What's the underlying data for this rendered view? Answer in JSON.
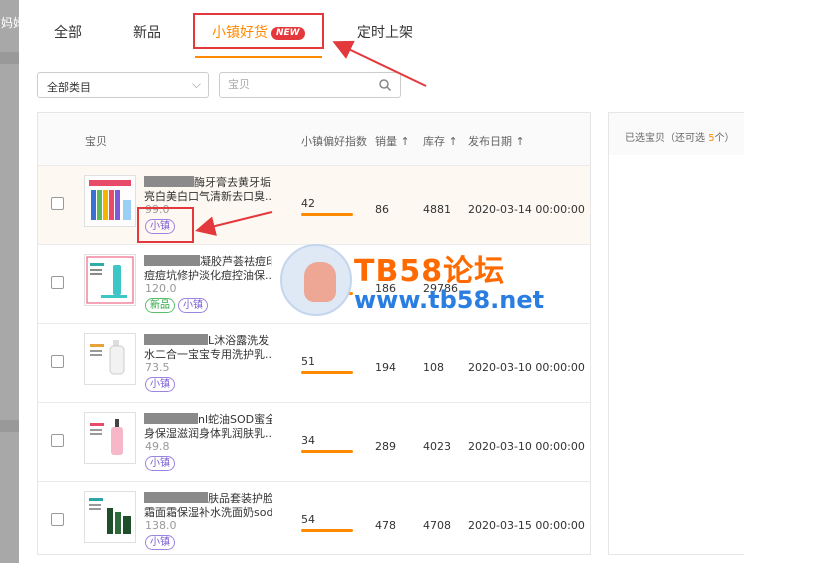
{
  "left_panel_label": "妈妈",
  "tabs": [
    {
      "label": "全部",
      "active": false
    },
    {
      "label": "新品",
      "active": false
    },
    {
      "label": "小镇好货",
      "active": true,
      "badge": "NEW"
    },
    {
      "label": "定时上架",
      "active": false
    }
  ],
  "filters": {
    "category_value": "全部类目",
    "search_placeholder": "宝贝"
  },
  "table": {
    "columns": {
      "item": "宝贝",
      "town_index": "小镇偏好指数",
      "sales": "销量 ↑",
      "stock": "库存 ↑",
      "publish_date": "发布日期 ↑"
    },
    "rows": [
      {
        "title_line1": "酶牙膏去黄牙垢",
        "title_line2": "亮白美白口气清新去口臭...",
        "price": "99.0",
        "tags": [
          "小镇"
        ],
        "town_index": "42",
        "sales": "86",
        "stock": "4881",
        "publish_date": "2020-03-14 00:00:00",
        "highlighted": true
      },
      {
        "title_line1": "凝胶芦荟祛痘印",
        "title_line2": "痘痘坑修护淡化痘控油保...",
        "price": "120.0",
        "tags": [
          "新品",
          "小镇"
        ],
        "town_index": "46",
        "sales": "186",
        "stock": "29786",
        "publish_date": "",
        "highlighted": false
      },
      {
        "title_line1": "L沐浴露洗发",
        "title_line2": "水二合一宝宝专用洗护乳...",
        "price": "73.5",
        "tags": [
          "小镇"
        ],
        "town_index": "51",
        "sales": "194",
        "stock": "108",
        "publish_date": "2020-03-10 00:00:00",
        "highlighted": false
      },
      {
        "title_line1": "nl蛇油SOD蜜全",
        "title_line2": "身保湿滋润身体乳润肤乳...",
        "price": "49.8",
        "tags": [
          "小镇"
        ],
        "town_index": "34",
        "sales": "289",
        "stock": "4023",
        "publish_date": "2020-03-10 00:00:00",
        "highlighted": false
      },
      {
        "title_line1": "肤品套装护脸",
        "title_line2": "霜面霜保湿补水洗面奶sod...",
        "price": "138.0",
        "tags": [
          "小镇"
        ],
        "town_index": "54",
        "sales": "478",
        "stock": "4708",
        "publish_date": "2020-03-15 00:00:00",
        "highlighted": false
      }
    ]
  },
  "selected_panel": {
    "prefix": "已选宝贝（还可选 ",
    "count": "5",
    "suffix": "个）"
  },
  "watermark": {
    "title": "TB58论坛",
    "url": "www.tb58.net"
  },
  "colors": {
    "accent": "#ff8a00",
    "annotation_red": "#e4393c",
    "town_tag": "#7b5cd6",
    "new_tag": "#2da641"
  }
}
